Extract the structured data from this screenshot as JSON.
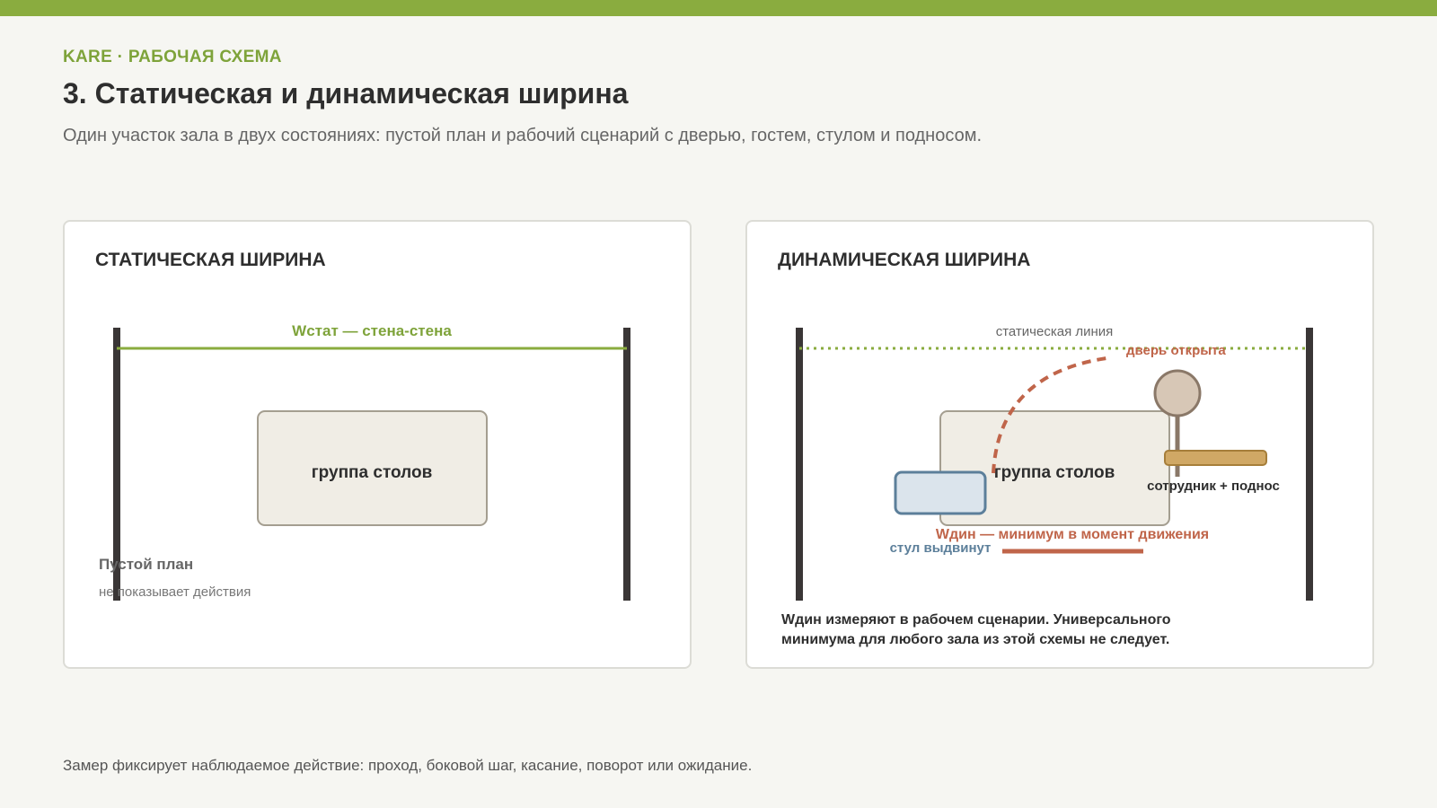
{
  "header": {
    "eyebrow": "KARE · РАБОЧАЯ СХЕМА",
    "title": "3. Статическая и динамическая ширина",
    "subtitle": "Один участок зала в двух состояниях: пустой план и рабочий сценарий с дверью, гостем, стулом и подносом."
  },
  "static_panel": {
    "heading": "СТАТИЧЕСКАЯ ШИРИНА",
    "width_label": "Wстат — стена-стена",
    "table_label": "группа столов",
    "caption_title": "Пустой план",
    "caption_text": "не показывает действия"
  },
  "dynamic_panel": {
    "heading": "ДИНАМИЧЕСКАЯ ШИРИНА",
    "static_line_label": "статическая линия",
    "door_label": "дверь открыта",
    "table_label": "группа столов",
    "staff_label": "сотрудник + поднос",
    "width_label": "Wдин — минимум в момент движения",
    "chair_label": "стул выдвинут",
    "note_line1": "Wдин измеряют в рабочем сценарии. Универсального",
    "note_line2": "минимума для любого зала из этой схемы не следует."
  },
  "footer": {
    "text": "Замер фиксирует наблюдаемое действие: проход, боковой шаг, касание, поворот или ожидание."
  },
  "colors": {
    "accent_green": "#8aac3f",
    "door_red": "#c0654a",
    "chair_blue": "#5c7f9a",
    "wall": "#3a3636",
    "table_fill": "#f0ede5",
    "tray": "#d0a865",
    "person": "#d7c7b6"
  }
}
